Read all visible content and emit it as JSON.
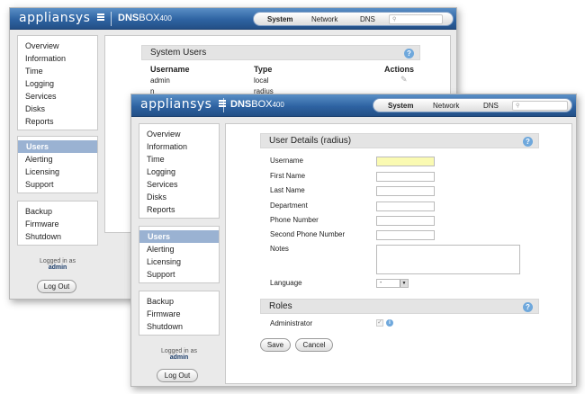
{
  "brand": {
    "logo_text": "appliansys",
    "product_bold": "DNS",
    "product_rest": "BOX",
    "product_model": "400"
  },
  "topnav": {
    "items": [
      "System",
      "Network",
      "DNS"
    ],
    "active": "System",
    "search_placeholder": ""
  },
  "back_window": {
    "nav_main": [
      "Overview",
      "Information",
      "Time",
      "Logging",
      "Services",
      "Disks",
      "Reports"
    ],
    "nav_users": [
      "Users",
      "Alerting",
      "Licensing",
      "Support"
    ],
    "nav_system": [
      "Backup",
      "Firmware",
      "Shutdown"
    ],
    "logged_in_label": "Logged in as",
    "logged_in_user": "admin",
    "logout_label": "Log Out",
    "section_title": "System Users",
    "table": {
      "headers": [
        "Username",
        "Type",
        "Actions"
      ],
      "rows": [
        {
          "username": "admin",
          "type": "local"
        },
        {
          "username": "n",
          "type": "radius"
        }
      ]
    }
  },
  "front_window": {
    "nav_main": [
      "Overview",
      "Information",
      "Time",
      "Logging",
      "Services",
      "Disks",
      "Reports"
    ],
    "nav_users": [
      "Users",
      "Alerting",
      "Licensing",
      "Support"
    ],
    "nav_system": [
      "Backup",
      "Firmware",
      "Shutdown"
    ],
    "logged_in_label": "Logged in as",
    "logged_in_user": "admin",
    "logout_label": "Log Out",
    "user_details_title": "User Details (radius)",
    "fields": {
      "username": {
        "label": "Username",
        "value": ""
      },
      "first_name": {
        "label": "First Name",
        "value": ""
      },
      "last_name": {
        "label": "Last Name",
        "value": ""
      },
      "department": {
        "label": "Department",
        "value": ""
      },
      "phone": {
        "label": "Phone Number",
        "value": ""
      },
      "phone2": {
        "label": "Second Phone Number",
        "value": ""
      },
      "notes": {
        "label": "Notes",
        "value": ""
      }
    },
    "language_label": "Language",
    "language_value": "-",
    "roles_title": "Roles",
    "administrator_label": "Administrator",
    "save_label": "Save",
    "cancel_label": "Cancel"
  },
  "colors": {
    "header_blue": "#2e63a2",
    "selected_nav": "#9ab2d2",
    "required_field": "#fafab2"
  }
}
